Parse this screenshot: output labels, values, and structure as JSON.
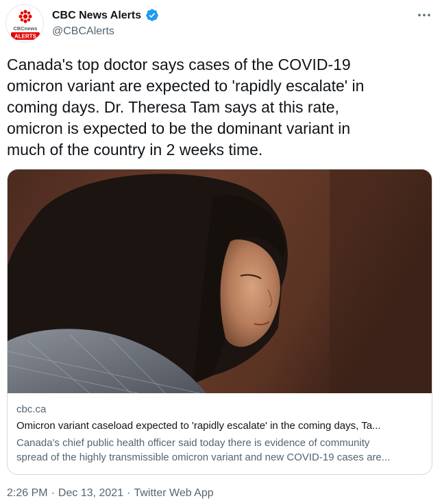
{
  "author": {
    "name": "CBC News Alerts",
    "handle": "@CBCAlerts",
    "verified": true,
    "avatar_text_top": "CBCnews",
    "avatar_text_bottom": "ALERTS",
    "avatar_icon": "cbc-gem-logo"
  },
  "tweet": {
    "text": "Canada's top doctor says cases of the COVID-19 omicron variant are expected to 'rapidly escalate' in coming days. Dr. Theresa Tam says at this rate, omicron is expected to be the dominant variant in much of the country in 2 weeks time.",
    "lines": [
      "Canada's top doctor says cases of the COVID-19",
      "omicron variant are expected to 'rapidly escalate' in",
      "coming days. Dr. Theresa Tam says at this rate,",
      "omicron is expected to be the dominant variant in",
      "much of the country in 2 weeks time."
    ]
  },
  "card": {
    "domain": "cbc.ca",
    "title": "Omicron variant caseload expected to 'rapidly escalate' in the coming days, Ta...",
    "description_lines": [
      "Canada's chief public health officer said today there is evidence of community",
      "spread of the highly transmissible omicron variant and new COVID-19 cases are..."
    ]
  },
  "meta": {
    "time": "2:26 PM",
    "date": "Dec 13, 2021",
    "source": "Twitter Web App",
    "separator": "·"
  },
  "icons": {
    "more": "more-options-icon",
    "verified": "verified-badge-icon"
  },
  "colors": {
    "text": "#0f1419",
    "secondary": "#536471",
    "verified_blue": "#1d9bf0",
    "cbc_red": "#e60505",
    "card_border": "#cfd9de"
  }
}
